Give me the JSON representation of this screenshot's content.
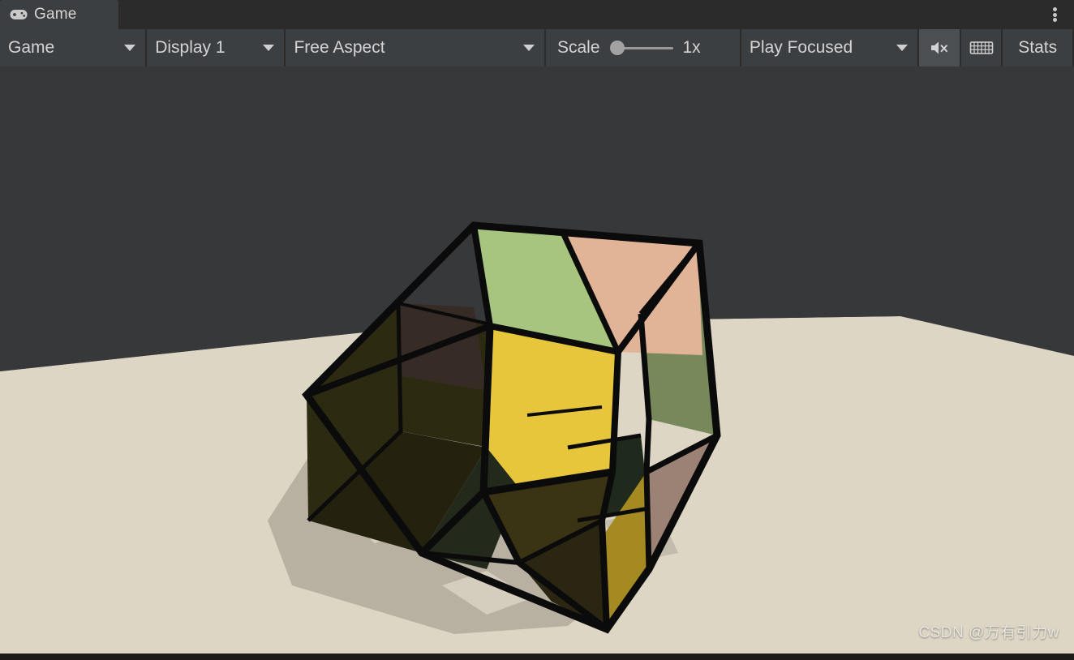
{
  "window": {
    "tab_label": "Game",
    "tab_icon": "gamepad-icon",
    "overflow_menu_icon": "kebab-menu-icon"
  },
  "toolbar": {
    "view_selector": {
      "label": "Game",
      "icon": "chevron-down-icon"
    },
    "display_selector": {
      "label": "Display 1",
      "icon": "chevron-down-icon"
    },
    "aspect_selector": {
      "label": "Free Aspect",
      "icon": "chevron-down-icon"
    },
    "scale": {
      "label": "Scale",
      "value": "1x",
      "slider_position_pct": 0
    },
    "play_mode_selector": {
      "label": "Play Focused",
      "icon": "chevron-down-icon"
    },
    "mute_audio": {
      "icon": "mute-audio-icon",
      "active": true,
      "label": ""
    },
    "gizmos": {
      "icon": "gizmos-grid-icon",
      "label": ""
    },
    "stats": {
      "label": "Stats"
    }
  },
  "viewport": {
    "scene_name": "rotated-rubiks-cube-scene",
    "background_color": "#37383a",
    "ground_color": "#ddd6c5",
    "ground_shadow_color": "#b9b3a4",
    "edge_color": "#0a0a0a",
    "cube": {
      "type": "2x2-rubiks-cube",
      "orientation": "tilted-corner-toward-viewer",
      "stickers": [
        {
          "name": "top-left-green",
          "color": "#a8c57f"
        },
        {
          "name": "top-right-peach",
          "color": "#e2b497"
        },
        {
          "name": "front-left-dark-olive",
          "color": "#2d2a12"
        },
        {
          "name": "front-mid-dark-brown",
          "color": "#362b25"
        },
        {
          "name": "front-yellow",
          "color": "#e8c63c"
        },
        {
          "name": "right-upper-green",
          "color": "#77885a"
        },
        {
          "name": "right-lower-tan",
          "color": "#9c8274"
        },
        {
          "name": "lower-front-olive",
          "color": "#3a3415"
        },
        {
          "name": "lower-front-dark",
          "color": "#232a1c"
        },
        {
          "name": "inner-dark-green",
          "color": "#1f2a1c"
        },
        {
          "name": "inner-olive",
          "color": "#4a4118"
        },
        {
          "name": "bottom-right-ochre",
          "color": "#a58a22"
        },
        {
          "name": "inner-shadow-brown",
          "color": "#2b2318"
        }
      ]
    },
    "watermark": "CSDN @万有引力w"
  }
}
